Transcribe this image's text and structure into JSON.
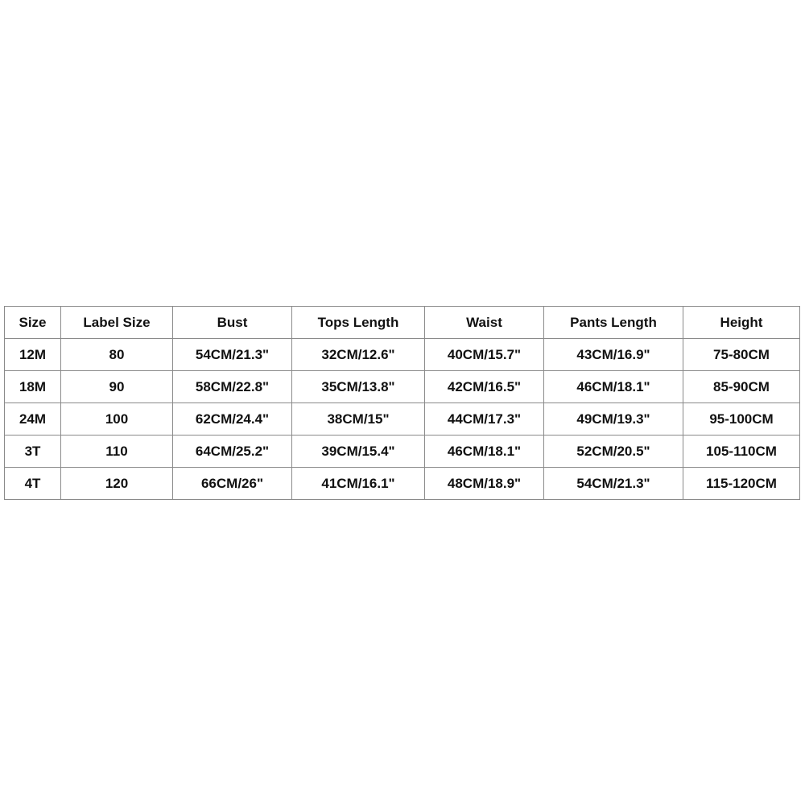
{
  "size_chart": {
    "headers": [
      "Size",
      "Label Size",
      "Bust",
      "Tops Length",
      "Waist",
      "Pants Length",
      "Height"
    ],
    "rows": [
      [
        "12M",
        "80",
        "54CM/21.3\"",
        "32CM/12.6\"",
        "40CM/15.7\"",
        "43CM/16.9\"",
        "75-80CM"
      ],
      [
        "18M",
        "90",
        "58CM/22.8\"",
        "35CM/13.8\"",
        "42CM/16.5\"",
        "46CM/18.1\"",
        "85-90CM"
      ],
      [
        "24M",
        "100",
        "62CM/24.4\"",
        "38CM/15\"",
        "44CM/17.3\"",
        "49CM/19.3\"",
        "95-100CM"
      ],
      [
        "3T",
        "110",
        "64CM/25.2\"",
        "39CM/15.4\"",
        "46CM/18.1\"",
        "52CM/20.5\"",
        "105-110CM"
      ],
      [
        "4T",
        "120",
        "66CM/26\"",
        "41CM/16.1\"",
        "48CM/18.9\"",
        "54CM/21.3\"",
        "115-120CM"
      ]
    ]
  },
  "colors": {
    "border": "#8a8a8a",
    "text": "#111111",
    "background": "#ffffff"
  }
}
